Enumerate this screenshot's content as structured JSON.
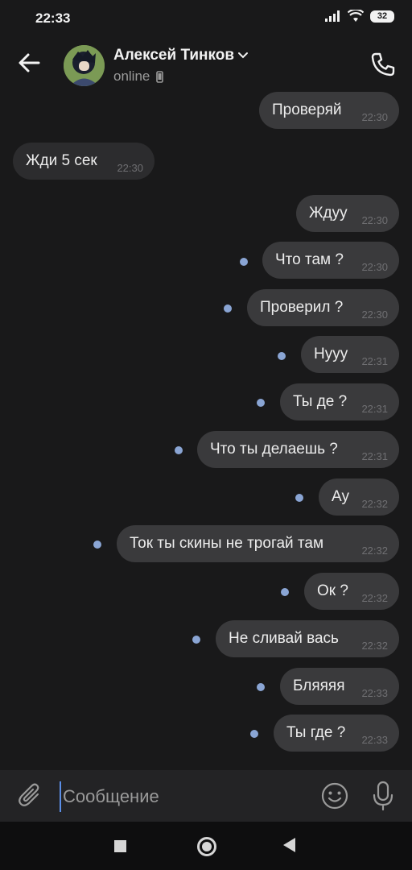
{
  "status_bar": {
    "time": "22:33",
    "battery": "32"
  },
  "header": {
    "contact_name": "Алексей Тинков",
    "status": "online"
  },
  "messages": [
    {
      "text": "Проверяй",
      "time": "22:30",
      "direction": "out",
      "unread": false
    },
    {
      "text": "Жди 5 сек",
      "time": "22:30",
      "direction": "in",
      "unread": false
    },
    {
      "text": "Ждуу",
      "time": "22:30",
      "direction": "out",
      "unread": false
    },
    {
      "text": "Что там ?",
      "time": "22:30",
      "direction": "out",
      "unread": true
    },
    {
      "text": "Проверил ?",
      "time": "22:30",
      "direction": "out",
      "unread": true
    },
    {
      "text": "Нууу",
      "time": "22:31",
      "direction": "out",
      "unread": true
    },
    {
      "text": "Ты де ?",
      "time": "22:31",
      "direction": "out",
      "unread": true
    },
    {
      "text": "Что ты делаешь ?",
      "time": "22:31",
      "direction": "out",
      "unread": true
    },
    {
      "text": "Ау",
      "time": "22:32",
      "direction": "out",
      "unread": true
    },
    {
      "text": "Ток ты скины не трогай там",
      "time": "22:32",
      "direction": "out",
      "unread": true
    },
    {
      "text": "Ок ?",
      "time": "22:32",
      "direction": "out",
      "unread": true
    },
    {
      "text": "Не сливай вась",
      "time": "22:32",
      "direction": "out",
      "unread": true
    },
    {
      "text": "Бляяяя",
      "time": "22:33",
      "direction": "out",
      "unread": true
    },
    {
      "text": "Ты где ?",
      "time": "22:33",
      "direction": "out",
      "unread": true
    }
  ],
  "composer": {
    "placeholder": "Сообщение"
  },
  "colors": {
    "background": "#19191a",
    "bubble": "#3a3a3c",
    "unread_dot": "#8aa5d4",
    "accent": "#5b8ee6"
  }
}
